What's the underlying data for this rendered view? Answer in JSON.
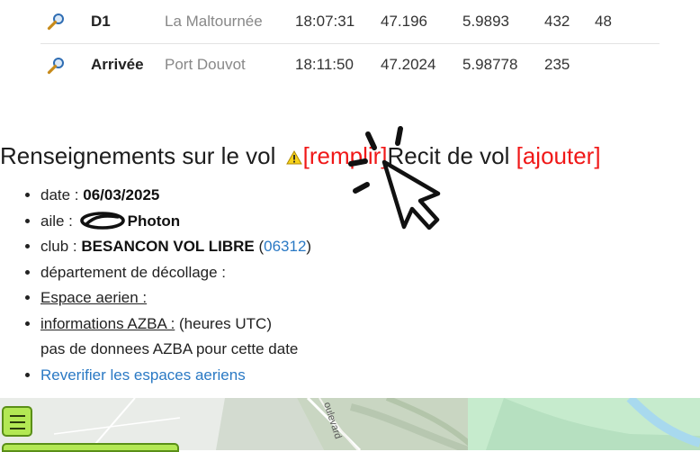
{
  "waypoints": [
    {
      "name": "D1",
      "place": "La Maltournée",
      "time": "18:07:31",
      "lat": "47.196",
      "lon": "5.9893",
      "alt": "432",
      "extra": "48"
    },
    {
      "name": "Arrivée",
      "place": "Port Douvot",
      "time": "18:11:50",
      "lat": "47.2024",
      "lon": "5.98778",
      "alt": "235",
      "extra": ""
    }
  ],
  "section": {
    "title": "Renseignements sur le vol",
    "fill_link": "[remplir]",
    "recit_title": "Recit de vol",
    "add_link": "[ajouter]"
  },
  "info": {
    "date_label": "date : ",
    "date_value": "06/03/2025",
    "aile_label": "aile : ",
    "aile_value": "Photon",
    "club_label": "club : ",
    "club_value": "BESANCON VOL LIBRE",
    "club_code": "06312",
    "departement_label": "département de décollage :",
    "espace_label": "Espace aerien :",
    "azba_label": "informations AZBA :",
    "azba_suffix": " (heures UTC)",
    "azba_note": "pas de donnees AZBA pour cette date",
    "reverifier_link": "Reverifier les espaces aeriens"
  },
  "map": {
    "street_label": "oulevard"
  },
  "icons": {
    "zoom": "magnifier-icon",
    "warning": "warning-icon",
    "menu": "hamburger-menu-icon",
    "cursor": "click-cursor-icon"
  },
  "colors": {
    "link_red": "#f01818",
    "link_blue": "#2a79c4",
    "menu_green": "#b3e854"
  }
}
